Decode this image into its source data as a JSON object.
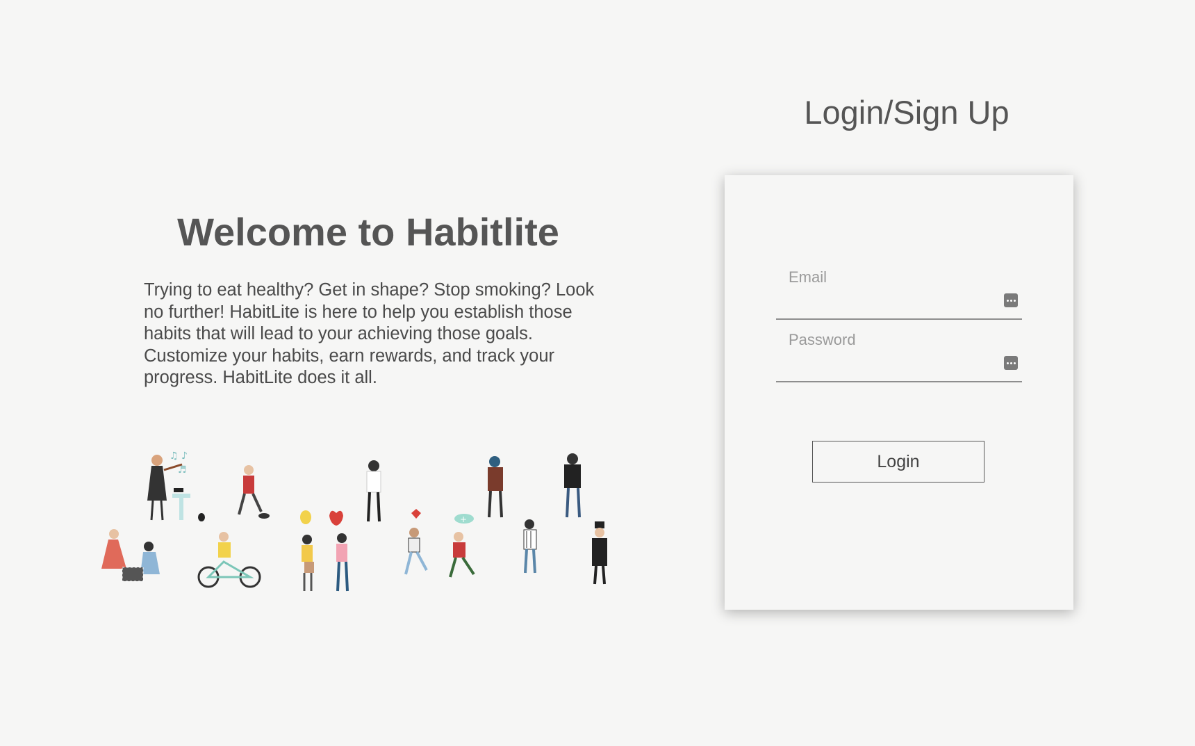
{
  "welcome": {
    "title": "Welcome to Habitlite",
    "description": "Trying to eat healthy? Get in shape? Stop smoking? Look no further! HabitLite is here to help you establish those habits that will lead to your achieving those goals. Customize your habits, earn rewards, and track your progress. HabitLite does it all."
  },
  "illustration": {
    "icon": "people-activities-illustration"
  },
  "login": {
    "title": "Login/Sign Up",
    "email_label": "Email",
    "email_value": "",
    "password_label": "Password",
    "password_value": "",
    "field_icon": "password-manager-icon",
    "button_label": "Login"
  },
  "colors": {
    "background": "#f6f6f5",
    "text": "#555555",
    "field_label": "#9a9a9a",
    "underline": "#8e8e8e"
  }
}
